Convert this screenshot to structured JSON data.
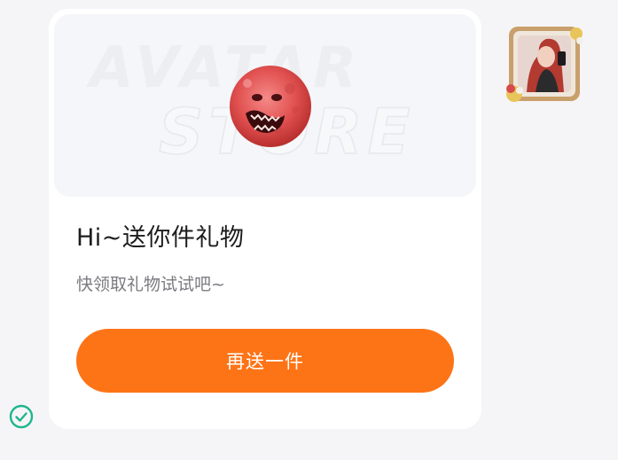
{
  "banner": {
    "watermark_top": "AVATAR",
    "watermark_bottom": "STORE"
  },
  "gift_card": {
    "title": "Hi~送你件礼物",
    "subtitle": "快领取礼物试试吧~",
    "button_label": "再送一件"
  },
  "colors": {
    "accent": "#fd7417",
    "page_background": "#f5f5f7",
    "card_background": "#ffffff",
    "status_check": "#1fb58f"
  },
  "icons": {
    "mascot": "red-moon-face-icon",
    "avatar": "user-avatar",
    "status": "check-circle-icon"
  }
}
